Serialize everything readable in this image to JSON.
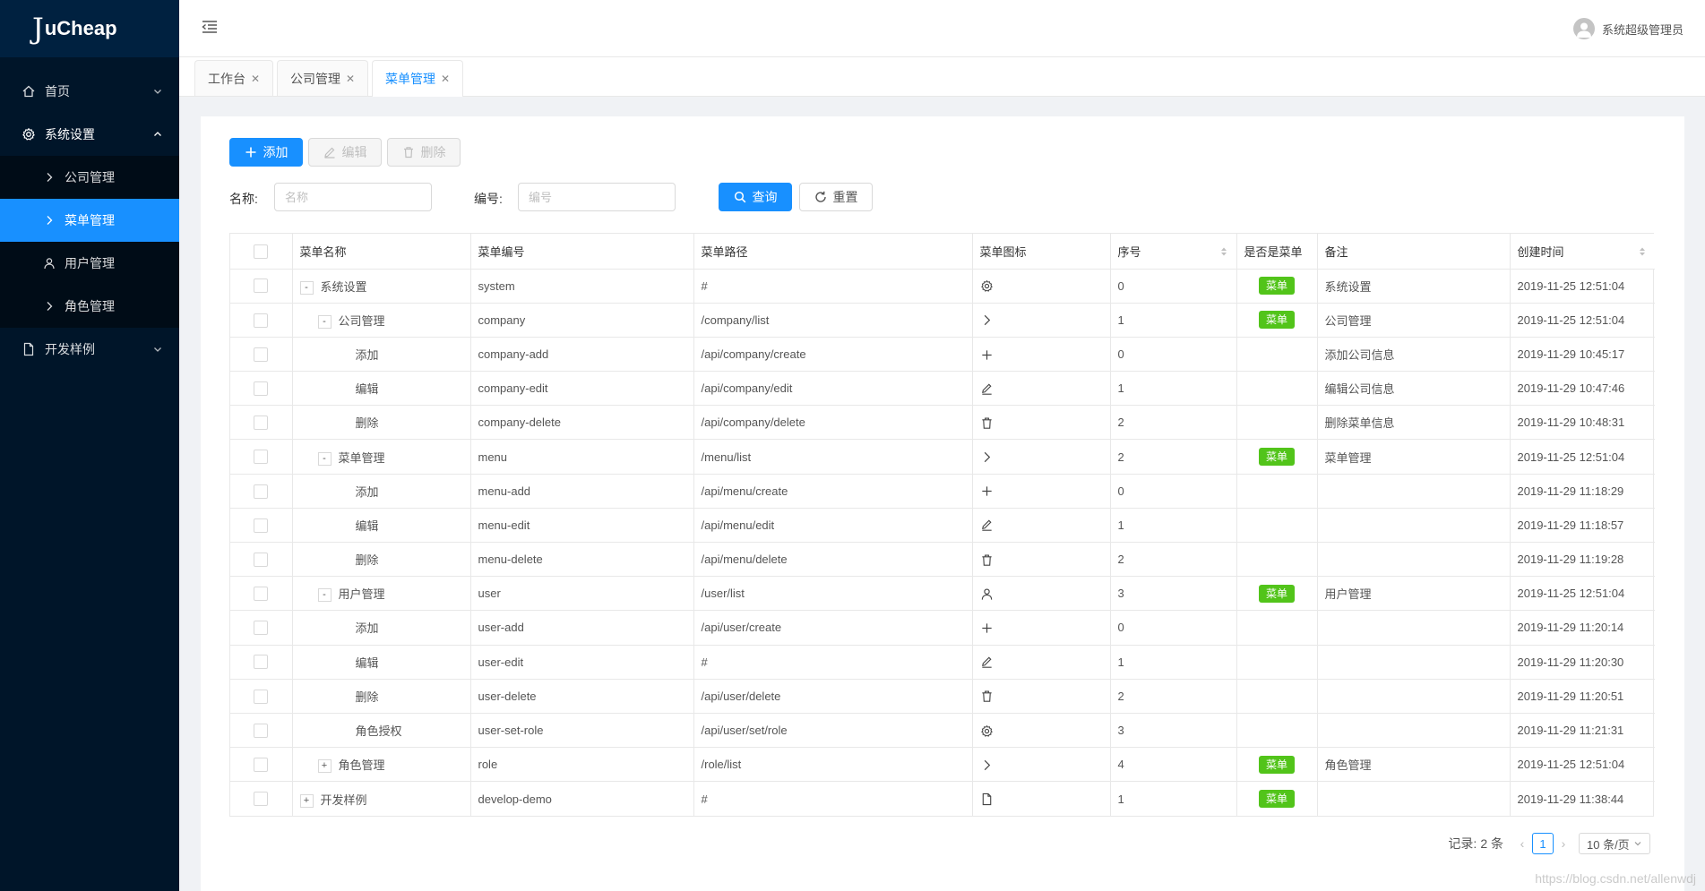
{
  "logo": {
    "first": "J",
    "rest": "uCheap"
  },
  "sidebar": {
    "home": "首页",
    "system": "系统设置",
    "sub": [
      "公司管理",
      "菜单管理",
      "用户管理",
      "角色管理"
    ],
    "dev": "开发样例"
  },
  "header": {
    "user": "系统超级管理员"
  },
  "tabs": [
    "工作台",
    "公司管理",
    "菜单管理"
  ],
  "toolbar": {
    "add": "添加",
    "edit": "编辑",
    "delete": "删除"
  },
  "filter": {
    "name_label": "名称:",
    "name_placeholder": "名称",
    "code_label": "编号:",
    "code_placeholder": "编号",
    "search": "查询",
    "reset": "重置"
  },
  "table": {
    "columns": [
      "菜单名称",
      "菜单编号",
      "菜单路径",
      "菜单图标",
      "序号",
      "是否是菜单",
      "备注",
      "创建时间"
    ],
    "rows": [
      {
        "name": "系统设置",
        "level": 0,
        "expander": "-",
        "code": "system",
        "path": "#",
        "icon": "gear",
        "order": "0",
        "menu": "菜单",
        "remark": "系统设置",
        "time": "2019-11-25 12:51:04"
      },
      {
        "name": "公司管理",
        "level": 1,
        "expander": "-",
        "code": "company",
        "path": "/company/list",
        "icon": "right",
        "order": "1",
        "menu": "菜单",
        "remark": "公司管理",
        "time": "2019-11-25 12:51:04"
      },
      {
        "name": "添加",
        "level": 2,
        "expander": "",
        "code": "company-add",
        "path": "/api/company/create",
        "icon": "plus",
        "order": "0",
        "menu": "",
        "remark": "添加公司信息",
        "time": "2019-11-29 10:45:17"
      },
      {
        "name": "编辑",
        "level": 2,
        "expander": "",
        "code": "company-edit",
        "path": "/api/company/edit",
        "icon": "edit",
        "order": "1",
        "menu": "",
        "remark": "编辑公司信息",
        "time": "2019-11-29 10:47:46"
      },
      {
        "name": "删除",
        "level": 2,
        "expander": "",
        "code": "company-delete",
        "path": "/api/company/delete",
        "icon": "delete",
        "order": "2",
        "menu": "",
        "remark": "删除菜单信息",
        "time": "2019-11-29 10:48:31"
      },
      {
        "name": "菜单管理",
        "level": 1,
        "expander": "-",
        "code": "menu",
        "path": "/menu/list",
        "icon": "right",
        "order": "2",
        "menu": "菜单",
        "remark": "菜单管理",
        "time": "2019-11-25 12:51:04"
      },
      {
        "name": "添加",
        "level": 2,
        "expander": "",
        "code": "menu-add",
        "path": "/api/menu/create",
        "icon": "plus",
        "order": "0",
        "menu": "",
        "remark": "",
        "time": "2019-11-29 11:18:29"
      },
      {
        "name": "编辑",
        "level": 2,
        "expander": "",
        "code": "menu-edit",
        "path": "/api/menu/edit",
        "icon": "edit",
        "order": "1",
        "menu": "",
        "remark": "",
        "time": "2019-11-29 11:18:57"
      },
      {
        "name": "删除",
        "level": 2,
        "expander": "",
        "code": "menu-delete",
        "path": "/api/menu/delete",
        "icon": "delete",
        "order": "2",
        "menu": "",
        "remark": "",
        "time": "2019-11-29 11:19:28"
      },
      {
        "name": "用户管理",
        "level": 1,
        "expander": "-",
        "code": "user",
        "path": "/user/list",
        "icon": "user",
        "order": "3",
        "menu": "菜单",
        "remark": "用户管理",
        "time": "2019-11-25 12:51:04"
      },
      {
        "name": "添加",
        "level": 2,
        "expander": "",
        "code": "user-add",
        "path": "/api/user/create",
        "icon": "plus",
        "order": "0",
        "menu": "",
        "remark": "",
        "time": "2019-11-29 11:20:14"
      },
      {
        "name": "编辑",
        "level": 2,
        "expander": "",
        "code": "user-edit",
        "path": "#",
        "icon": "edit",
        "order": "1",
        "menu": "",
        "remark": "",
        "time": "2019-11-29 11:20:30"
      },
      {
        "name": "删除",
        "level": 2,
        "expander": "",
        "code": "user-delete",
        "path": "/api/user/delete",
        "icon": "delete",
        "order": "2",
        "menu": "",
        "remark": "",
        "time": "2019-11-29 11:20:51"
      },
      {
        "name": "角色授权",
        "level": 2,
        "expander": "",
        "code": "user-set-role",
        "path": "/api/user/set/role",
        "icon": "gear",
        "order": "3",
        "menu": "",
        "remark": "",
        "time": "2019-11-29 11:21:31"
      },
      {
        "name": "角色管理",
        "level": 1,
        "expander": "+",
        "code": "role",
        "path": "/role/list",
        "icon": "right",
        "order": "4",
        "menu": "菜单",
        "remark": "角色管理",
        "time": "2019-11-25 12:51:04"
      },
      {
        "name": "开发样例",
        "level": 0,
        "expander": "+",
        "code": "develop-demo",
        "path": "#",
        "icon": "file",
        "order": "1",
        "menu": "菜单",
        "remark": "",
        "time": "2019-11-29 11:38:44"
      }
    ]
  },
  "pagination": {
    "total_label": "记录:",
    "total": "2 条",
    "current": "1",
    "page_size": "10 条/页"
  },
  "watermark": "https://blog.csdn.net/allenwdj"
}
